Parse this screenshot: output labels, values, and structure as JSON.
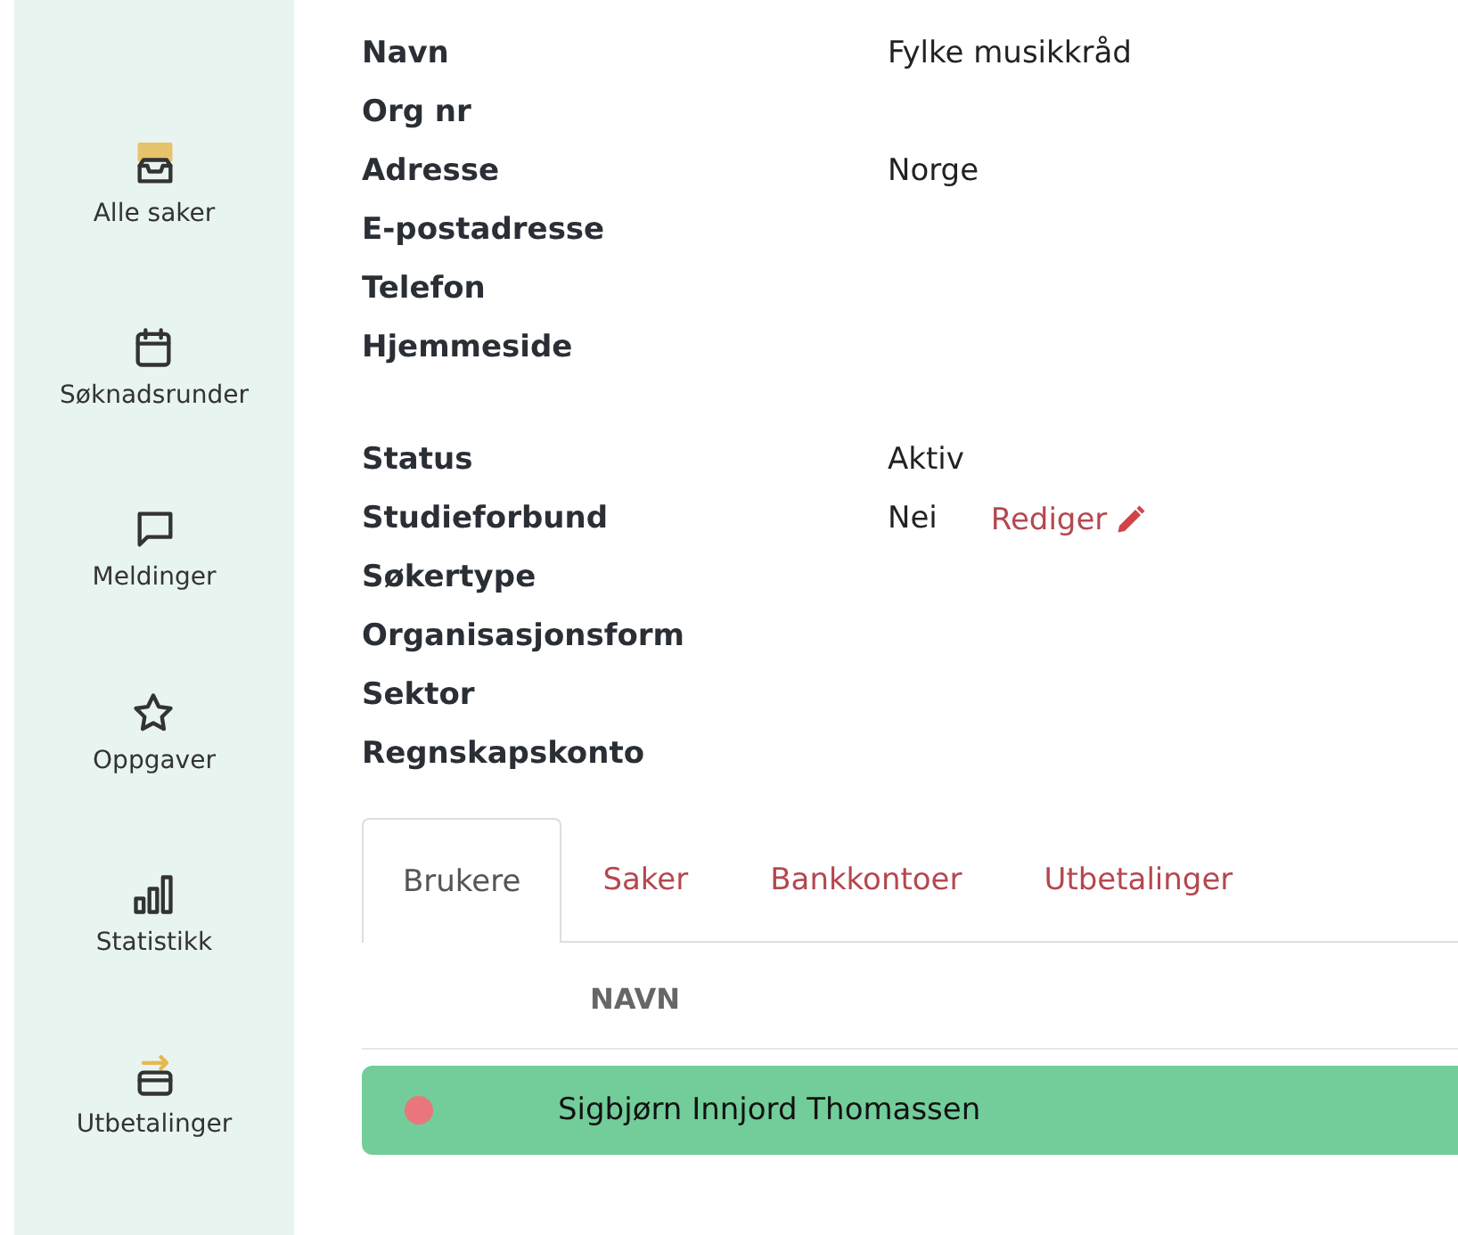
{
  "sidebar": {
    "items": [
      {
        "label": "Alle saker",
        "kind": "inbox"
      },
      {
        "label": "Søknadsrunder",
        "kind": "calendar"
      },
      {
        "label": "Meldinger",
        "kind": "message"
      },
      {
        "label": "Oppgaver",
        "kind": "star"
      },
      {
        "label": "Statistikk",
        "kind": "chart"
      },
      {
        "label": "Utbetalinger",
        "kind": "payment"
      }
    ]
  },
  "details": {
    "groups": [
      [
        {
          "label": "Navn",
          "value": "Fylke musikkråd"
        },
        {
          "label": "Org nr"
        },
        {
          "label": "Adresse",
          "value": "Norge"
        },
        {
          "label": "E-postadresse"
        },
        {
          "label": "Telefon"
        },
        {
          "label": "Hjemmeside"
        }
      ],
      [
        {
          "label": "Status",
          "value": "Aktiv"
        },
        {
          "label": "Studieforbund",
          "value": "Nei",
          "action": "Rediger"
        },
        {
          "label": "Søkertype"
        },
        {
          "label": "Organisasjonsform"
        },
        {
          "label": "Sektor"
        },
        {
          "label": "Regnskapskonto"
        }
      ]
    ]
  },
  "tabs": [
    {
      "label": "Brukere",
      "selected": true
    },
    {
      "label": "Saker",
      "selected": false
    },
    {
      "label": "Bankkontoer",
      "selected": false
    },
    {
      "label": "Utbetalinger",
      "selected": false
    }
  ],
  "table": {
    "columns": [
      "NAVN"
    ],
    "rows": [
      {
        "name": "Sigbjørn Innjord Thomassen",
        "color": "#e8767a",
        "selected": true
      }
    ]
  }
}
